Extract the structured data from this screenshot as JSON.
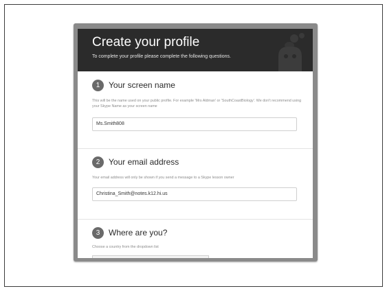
{
  "header": {
    "title": "Create your profile",
    "subtitle": "To complete your profile please complete the following questions."
  },
  "sections": [
    {
      "number": "1",
      "title": "Your screen name",
      "help": "This will be the name used on your public profile. For example 'Mrs Aldman' or 'SouthCoastBiology'. We don't recommend using your Skype Name as your screen name",
      "value": "Ms.Smith808"
    },
    {
      "number": "2",
      "title": "Your email address",
      "help": "Your email address will only be shown if you send a message to a Skype lesson owner",
      "value": "Christina_Smith@notes.k12.hi.us"
    },
    {
      "number": "3",
      "title": "Where are you?",
      "help": "Choose a country from the dropdown list"
    }
  ],
  "colors": {
    "header_bg": "#2b2b2b",
    "step_circle": "#6a6a6a"
  }
}
